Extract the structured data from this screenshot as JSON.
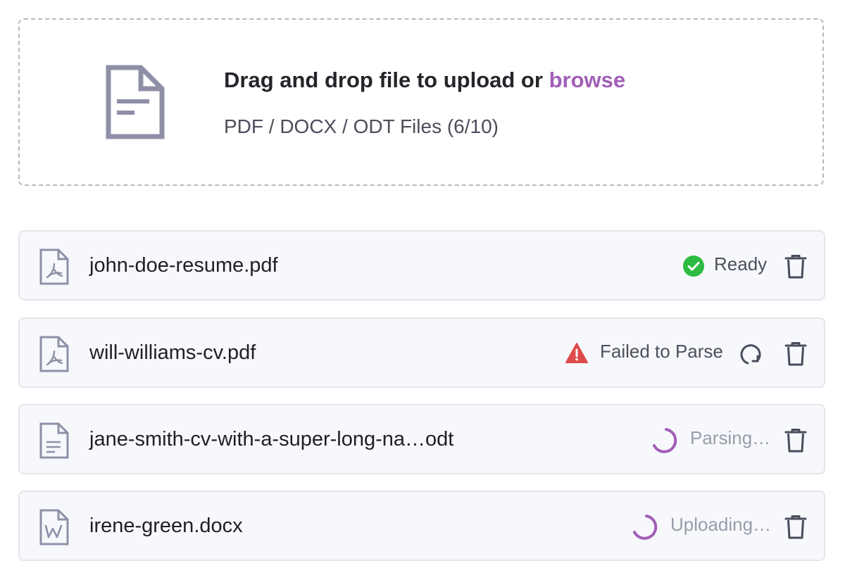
{
  "upload": {
    "title_prefix": "Drag and drop file to upload or ",
    "browse_label": "browse",
    "subtitle": "PDF / DOCX / ODT Files (6/10)",
    "icon": "document-icon"
  },
  "files": [
    {
      "name": "john-doe-resume.pdf",
      "type_icon": "pdf-file-icon",
      "status": "Ready",
      "status_icon": "check-circle-icon",
      "status_color": "#2dbb42"
    },
    {
      "name": "will-williams-cv.pdf",
      "type_icon": "pdf-file-icon",
      "status": "Failed to Parse",
      "status_icon": "warning-triangle-icon",
      "status_color": "#de4b4b"
    },
    {
      "name": "jane-smith-cv-with-a-super-long-na…odt",
      "type_icon": "text-file-icon",
      "status": "Parsing…",
      "status_icon": "spinner-icon",
      "status_color": "#a15fb6"
    },
    {
      "name": "irene-green.docx",
      "type_icon": "word-file-icon",
      "status": "Uploading…",
      "status_icon": "spinner-icon",
      "status_color": "#a15fb6"
    }
  ],
  "colors": {
    "accent": "#a15fb6",
    "icon_gray": "#8f90a8",
    "text": "#1f1f24",
    "status_text": "#4d4f5e",
    "muted_text": "#9a9cab"
  }
}
